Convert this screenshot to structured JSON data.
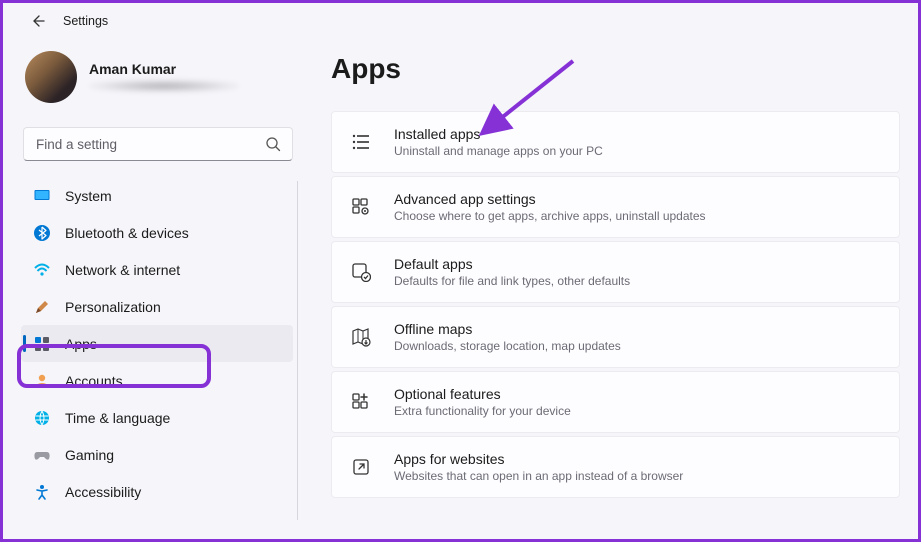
{
  "header": {
    "title": "Settings"
  },
  "profile": {
    "name": "Aman Kumar"
  },
  "search": {
    "placeholder": "Find a setting"
  },
  "sidebar": {
    "items": [
      {
        "label": "System"
      },
      {
        "label": "Bluetooth & devices"
      },
      {
        "label": "Network & internet"
      },
      {
        "label": "Personalization"
      },
      {
        "label": "Apps"
      },
      {
        "label": "Accounts"
      },
      {
        "label": "Time & language"
      },
      {
        "label": "Gaming"
      },
      {
        "label": "Accessibility"
      }
    ]
  },
  "page": {
    "title": "Apps"
  },
  "cards": [
    {
      "title": "Installed apps",
      "sub": "Uninstall and manage apps on your PC"
    },
    {
      "title": "Advanced app settings",
      "sub": "Choose where to get apps, archive apps, uninstall updates"
    },
    {
      "title": "Default apps",
      "sub": "Defaults for file and link types, other defaults"
    },
    {
      "title": "Offline maps",
      "sub": "Downloads, storage location, map updates"
    },
    {
      "title": "Optional features",
      "sub": "Extra functionality for your device"
    },
    {
      "title": "Apps for websites",
      "sub": "Websites that can open in an app instead of a browser"
    }
  ],
  "annotation": {
    "arrow_color": "#8531d6",
    "highlight_color": "#8531d6"
  }
}
